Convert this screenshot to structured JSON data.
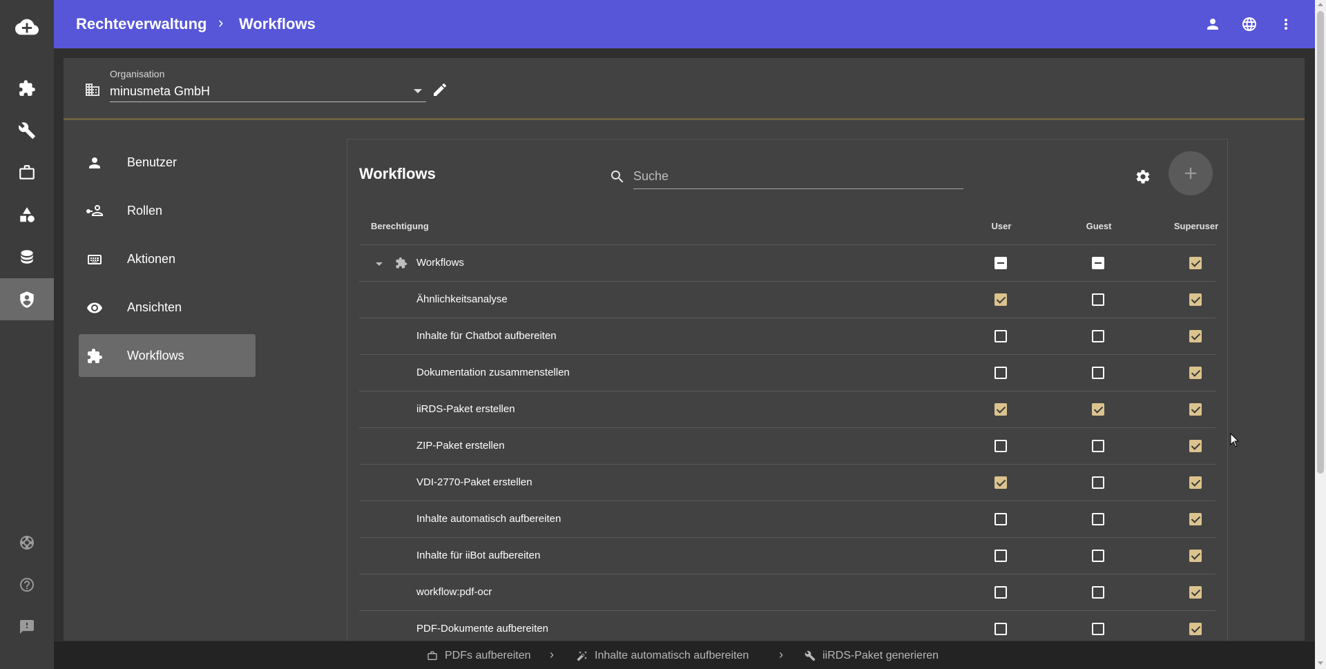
{
  "header": {
    "breadcrumb": [
      "Rechteverwaltung",
      "Workflows"
    ],
    "separator": "›",
    "icons": [
      "account-icon",
      "globe-icon",
      "more-vert-icon"
    ]
  },
  "rail": {
    "items": [
      "cloud-upload-icon",
      "puzzle-icon",
      "wrench-icon",
      "briefcase-icon",
      "shapes-icon",
      "database-icon",
      "shield-account-icon",
      "lifebuoy-icon",
      "help-icon",
      "feedback-icon"
    ],
    "active": "shield-account-icon"
  },
  "organisation": {
    "label": "Organisation",
    "value": "minusmeta GmbH"
  },
  "nav": {
    "items": [
      {
        "label": "Benutzer",
        "icon": "person-icon"
      },
      {
        "label": "Rollen",
        "icon": "role-icon"
      },
      {
        "label": "Aktionen",
        "icon": "keyboard-icon"
      },
      {
        "label": "Ansichten",
        "icon": "eye-icon"
      },
      {
        "label": "Workflows",
        "icon": "puzzle-icon"
      }
    ],
    "active": "Workflows"
  },
  "panel": {
    "title": "Workflows",
    "search_placeholder": "Suche"
  },
  "table": {
    "headers": {
      "permission": "Berechtigung",
      "user": "User",
      "guest": "Guest",
      "superuser": "Superuser"
    },
    "group": {
      "label": "Workflows",
      "user": "indeterminate",
      "guest": "indeterminate",
      "superuser": "checked"
    },
    "rows": [
      {
        "label": "Ähnlichkeitsanalyse",
        "user": true,
        "guest": false,
        "superuser": true
      },
      {
        "label": "Inhalte für Chatbot aufbereiten",
        "user": false,
        "guest": false,
        "superuser": true
      },
      {
        "label": "Dokumentation zusammenstellen",
        "user": false,
        "guest": false,
        "superuser": true
      },
      {
        "label": "iiRDS-Paket erstellen",
        "user": true,
        "guest": true,
        "superuser": true
      },
      {
        "label": "ZIP-Paket erstellen",
        "user": false,
        "guest": false,
        "superuser": true
      },
      {
        "label": "VDI-2770-Paket erstellen",
        "user": true,
        "guest": false,
        "superuser": true
      },
      {
        "label": "Inhalte automatisch aufbereiten",
        "user": false,
        "guest": false,
        "superuser": true
      },
      {
        "label": "Inhalte für iiBot aufbereiten",
        "user": false,
        "guest": false,
        "superuser": true
      },
      {
        "label": "workflow:pdf-ocr",
        "user": false,
        "guest": false,
        "superuser": true
      },
      {
        "label": "PDF-Dokumente aufbereiten",
        "user": false,
        "guest": false,
        "superuser": true
      }
    ]
  },
  "bottombar": {
    "items": [
      {
        "label": "PDFs aufbereiten",
        "icon": "briefcase-icon"
      },
      {
        "label": "Inhalte automatisch aufbereiten",
        "icon": "magic-wand-icon"
      },
      {
        "label": "iiRDS-Paket generieren",
        "icon": "wrench-icon"
      }
    ],
    "separator": "›"
  },
  "colors": {
    "header": "#5756d9",
    "checkbox_checked": "#dcc38e",
    "accent_line": "#6e6242"
  }
}
